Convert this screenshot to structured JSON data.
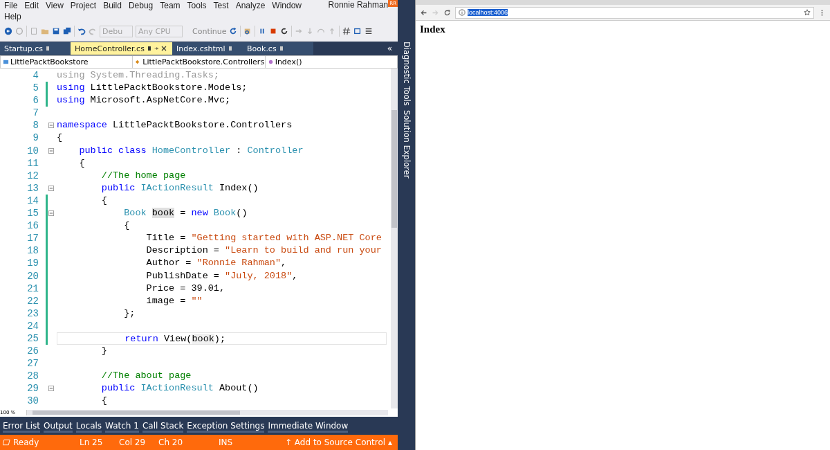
{
  "menu": {
    "items": [
      "File",
      "Edit",
      "View",
      "Project",
      "Build",
      "Debug",
      "Team",
      "Tools",
      "Test",
      "Analyze",
      "Window",
      "Help"
    ],
    "user": "Ronnie Rahman",
    "avatar": "RR"
  },
  "toolbar": {
    "configuration": "Debu",
    "platform": "Any CPU",
    "run": "Continue"
  },
  "doc_tabs": [
    {
      "label": "Startup.cs",
      "selected": false
    },
    {
      "label": "HomeController.cs",
      "selected": true
    },
    {
      "label": "Index.cshtml",
      "selected": false
    },
    {
      "label": "Book.cs",
      "selected": false
    }
  ],
  "nav_bar": {
    "project": "LittlePacktBookstore",
    "type": "LittlePacktBookstore.Controllers",
    "member": "Index()"
  },
  "overflow": "«",
  "lines": [
    {
      "number": "4",
      "changed": false,
      "fold": false,
      "current": false,
      "tokens": [
        {
          "kind": "dim",
          "text": "using System.Threading.Tasks;"
        }
      ]
    },
    {
      "number": "5",
      "changed": true,
      "fold": false,
      "current": false,
      "tokens": [
        {
          "kind": "keyword",
          "text": "using"
        },
        {
          "kind": "plain",
          "text": " LittlePacktBookstore.Models;"
        }
      ]
    },
    {
      "number": "6",
      "changed": true,
      "fold": false,
      "current": false,
      "tokens": [
        {
          "kind": "keyword",
          "text": "using"
        },
        {
          "kind": "plain",
          "text": " Microsoft.AspNetCore.Mvc;"
        }
      ]
    },
    {
      "number": "7",
      "changed": false,
      "fold": false,
      "current": false
    },
    {
      "number": "8",
      "changed": false,
      "fold": true,
      "current": false,
      "tokens": [
        {
          "kind": "keyword",
          "text": "namespace"
        },
        {
          "kind": "plain",
          "text": " LittlePacktBookstore.Controllers"
        }
      ]
    },
    {
      "number": "9",
      "changed": false,
      "fold": false,
      "current": false,
      "tokens": [
        {
          "kind": "plain",
          "text": "{"
        }
      ]
    },
    {
      "number": "10",
      "changed": false,
      "fold": true,
      "current": false,
      "tokens": [
        {
          "kind": "keyword",
          "text": "    public class"
        },
        {
          "kind": "type",
          "text": " HomeController"
        },
        {
          "kind": "plain",
          "text": " : "
        },
        {
          "kind": "type",
          "text": "Controller"
        }
      ]
    },
    {
      "number": "11",
      "changed": false,
      "fold": false,
      "current": false,
      "tokens": [
        {
          "kind": "plain",
          "text": "    {"
        }
      ]
    },
    {
      "number": "12",
      "changed": false,
      "fold": false,
      "current": false,
      "tokens": [
        {
          "kind": "comment",
          "text": "        //The home page"
        }
      ]
    },
    {
      "number": "13",
      "changed": false,
      "fold": true,
      "current": false,
      "tokens": [
        {
          "kind": "keyword",
          "text": "        public"
        },
        {
          "kind": "type",
          "text": " IActionResult"
        },
        {
          "kind": "plain",
          "text": " Index()"
        }
      ]
    },
    {
      "number": "14",
      "changed": true,
      "fold": false,
      "current": false,
      "tokens": [
        {
          "kind": "plain",
          "text": "        {"
        }
      ]
    },
    {
      "number": "15",
      "changed": true,
      "fold": true,
      "current": false,
      "tokens": [
        {
          "kind": "type",
          "text": "            Book "
        },
        {
          "kind": "ref",
          "text": "book"
        },
        {
          "kind": "plain",
          "text": " = "
        },
        {
          "kind": "keyword",
          "text": "new"
        },
        {
          "kind": "type",
          "text": " Book"
        },
        {
          "kind": "plain",
          "text": "()"
        }
      ]
    },
    {
      "number": "16",
      "changed": true,
      "fold": false,
      "current": false,
      "tokens": [
        {
          "kind": "plain",
          "text": "            {"
        }
      ]
    },
    {
      "number": "17",
      "changed": true,
      "fold": false,
      "current": false,
      "tokens": [
        {
          "kind": "plain",
          "text": "                Title = "
        },
        {
          "kind": "string",
          "text": "\"Getting started with ASP.NET Core"
        }
      ]
    },
    {
      "number": "18",
      "changed": true,
      "fold": false,
      "current": false,
      "tokens": [
        {
          "kind": "plain",
          "text": "                Description = "
        },
        {
          "kind": "string",
          "text": "\"Learn to build and run your"
        }
      ]
    },
    {
      "number": "19",
      "changed": true,
      "fold": false,
      "current": false,
      "tokens": [
        {
          "kind": "plain",
          "text": "                Author = "
        },
        {
          "kind": "string",
          "text": "\"Ronnie Rahman\""
        },
        {
          "kind": "plain",
          "text": ","
        }
      ]
    },
    {
      "number": "20",
      "changed": true,
      "fold": false,
      "current": false,
      "tokens": [
        {
          "kind": "plain",
          "text": "                PublishDate = "
        },
        {
          "kind": "string",
          "text": "\"July, 2018\""
        },
        {
          "kind": "plain",
          "text": ","
        }
      ]
    },
    {
      "number": "21",
      "changed": true,
      "fold": false,
      "current": false,
      "tokens": [
        {
          "kind": "plain",
          "text": "                Price = 39.01,"
        }
      ]
    },
    {
      "number": "22",
      "changed": true,
      "fold": false,
      "current": false,
      "tokens": [
        {
          "kind": "plain",
          "text": "                image = "
        },
        {
          "kind": "string",
          "text": "\"\""
        }
      ]
    },
    {
      "number": "23",
      "changed": true,
      "fold": false,
      "current": false,
      "tokens": [
        {
          "kind": "plain",
          "text": "            };"
        }
      ]
    },
    {
      "number": "24",
      "changed": true,
      "fold": false,
      "current": false
    },
    {
      "number": "25",
      "changed": true,
      "fold": false,
      "current": true,
      "tokens": [
        {
          "kind": "keyword",
          "text": "            return"
        },
        {
          "kind": "plain",
          "text": " View("
        },
        {
          "kind": "ref2",
          "text": "book"
        },
        {
          "kind": "plain",
          "text": ");"
        }
      ]
    },
    {
      "number": "26",
      "changed": false,
      "fold": false,
      "current": false,
      "tokens": [
        {
          "kind": "plain",
          "text": "        }"
        }
      ]
    },
    {
      "number": "27",
      "changed": false,
      "fold": false,
      "current": false
    },
    {
      "number": "28",
      "changed": false,
      "fold": false,
      "current": false,
      "tokens": [
        {
          "kind": "comment",
          "text": "        //The about page"
        }
      ]
    },
    {
      "number": "29",
      "changed": false,
      "fold": true,
      "current": false,
      "tokens": [
        {
          "kind": "keyword",
          "text": "        public"
        },
        {
          "kind": "type",
          "text": " IActionResult"
        },
        {
          "kind": "plain",
          "text": " About()"
        }
      ]
    },
    {
      "number": "30",
      "changed": false,
      "fold": false,
      "current": false,
      "tokens": [
        {
          "kind": "plain",
          "text": "        {"
        }
      ]
    }
  ],
  "zoom": "100 %",
  "side_tabs": [
    "Diagnostic Tools",
    "Solution Explorer"
  ],
  "tool_tabs": [
    "Error List",
    "Output",
    "Locals",
    "Watch 1",
    "Call Stack",
    "Exception Settings",
    "Immediate Window"
  ],
  "status_bar": {
    "state": "Ready",
    "line": "Ln 25",
    "column": "Col 29",
    "char": "Ch 20",
    "mode": "INS",
    "source_control": "↑ Add to Source Control ▴"
  },
  "browser": {
    "url": "localhost:4006",
    "heading": "Index"
  }
}
